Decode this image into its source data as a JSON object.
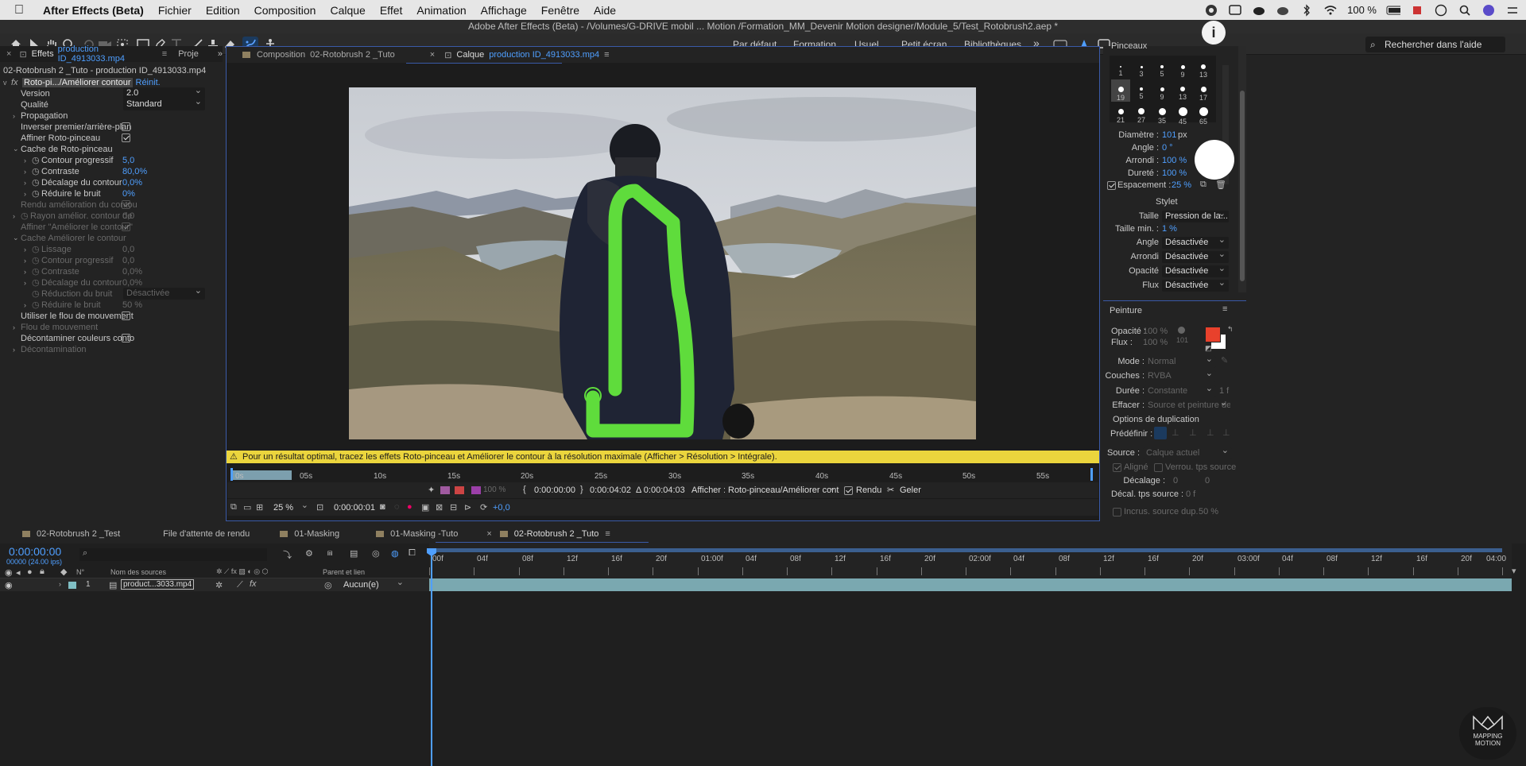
{
  "menubar": {
    "app_name": "After Effects (Beta)",
    "items": [
      "Fichier",
      "Edition",
      "Composition",
      "Calque",
      "Effet",
      "Animation",
      "Affichage",
      "Fenêtre",
      "Aide"
    ],
    "battery": "100 %"
  },
  "titlebar": {
    "title": "Adobe After Effects (Beta) - /Volumes/G-DRIVE mobil ... Motion /Formation_MM_Devenir Motion designer/Module_5/Test_Rotobrush2.aep *"
  },
  "workspaces": [
    "Par défaut",
    "Formation",
    "Usuel",
    "Petit écran",
    "Bibliothèques"
  ],
  "search_placeholder": "Rechercher dans l'aide",
  "effects_panel": {
    "tab_label": "Effets",
    "tab_layer": "production ID_4913033.mp4",
    "tab2": "Proje",
    "subtitle": "02-Rotobrush 2 _Tuto - production ID_4913033.mp4",
    "effect_name": "Roto-pi.../Améliorer contour",
    "reset": "Réinit.",
    "version_label": "Version",
    "version_value": "2.0",
    "quality_label": "Qualité",
    "quality_value": "Standard",
    "propagation": "Propagation",
    "invert": "Inverser premier/arrière-plan",
    "refine": "Affiner Roto-pinceau",
    "cache": "Cache de Roto-pinceau",
    "feather_label": "Contour progressif",
    "feather_value": "5,0",
    "contrast_label": "Contraste",
    "contrast_value": "80,0%",
    "shift_label": "Décalage du contour",
    "shift_value": "0,0%",
    "reduce_label": "Réduire le bruit",
    "reduce_value": "0%",
    "render_refine": "Rendu amélioration du contou",
    "radius_label": "Rayon amélior. contour de",
    "radius_value": "0,0",
    "refine_edge": "Affiner \"Améliorer le contour\"",
    "cache_refine": "Cache Améliorer le contour",
    "smooth_label": "Lissage",
    "smooth_value": "0,0",
    "feather2_label": "Contour progressif",
    "feather2_value": "0,0",
    "contrast2_label": "Contraste",
    "contrast2_value": "0,0%",
    "shift2_label": "Décalage du contour",
    "shift2_value": "0,0%",
    "noise_label": "Réduction du bruit",
    "noise_value": "Désactivée",
    "reduce2_label": "Réduire le bruit",
    "reduce2_value": "50 %",
    "motion_blur_use": "Utiliser le flou de mouvement",
    "motion_blur": "Flou de mouvement",
    "decontaminate": "Décontaminer couleurs conto",
    "decontamination": "Décontamination"
  },
  "viewer": {
    "tab1_prefix": "Composition",
    "tab1": "02-Rotobrush 2 _Tuto",
    "tab2_prefix": "Calque",
    "tab2": "production ID_4913033.mp4",
    "warning": "Pour un résultat optimal, tracez les effets Roto-pinceau et Améliorer le contour à la résolution maximale (Afficher > Résolution > Intégrale).",
    "ruler": [
      "0s",
      "05s",
      "10s",
      "15s",
      "20s",
      "25s",
      "30s",
      "35s",
      "40s",
      "45s",
      "50s",
      "55s"
    ],
    "timecode_in": "0:00:00:00",
    "timecode_out": "0:00:04:02",
    "duration": "Δ 0:00:04:03",
    "show_label": "Afficher :",
    "show_value": "Roto-pinceau/Améliorer cont...",
    "render": "Rendu",
    "freeze": "Geler",
    "zoom": "25 %",
    "current_time": "0:00:00:01",
    "exposure": "+0,0",
    "opacity_pct": "100 %"
  },
  "brushes_panel": {
    "title": "Pinceaux",
    "sizes": [
      "1",
      "3",
      "5",
      "9",
      "13",
      "19",
      "5",
      "9",
      "13",
      "17",
      "21",
      "27",
      "35",
      "45",
      "65"
    ],
    "diameter_label": "Diamètre :",
    "diameter_value": "101",
    "diameter_unit": "px",
    "angle_label": "Angle :",
    "angle_value": "0 °",
    "round_label": "Arrondi :",
    "round_value": "100 %",
    "hardness_label": "Dureté :",
    "hardness_value": "100 %",
    "spacing_label": "Espacement :",
    "spacing_value": "25 %",
    "stylus": "Stylet",
    "size_label": "Taille",
    "size_value": "Pression de la...",
    "minsize_label": "Taille min. :",
    "minsize_value": "1 %",
    "angle2_label": "Angle",
    "angle2_value": "Désactivée",
    "round2_label": "Arrondi",
    "round2_value": "Désactivée",
    "opacity_label": "Opacité",
    "opacity_value": "Désactivée",
    "flow_label": "Flux",
    "flow_value": "Désactivée"
  },
  "paint_panel": {
    "title": "Peinture",
    "opacity_label": "Opacité :",
    "opacity_value": "100 %",
    "flow_label": "Flux :",
    "flow_value": "100 %",
    "brush_num": "101",
    "fg_color": "#e8412c",
    "mode_label": "Mode :",
    "mode_value": "Normal",
    "channels_label": "Couches :",
    "channels_value": "RVBA",
    "duration_label": "Durée :",
    "duration_value": "Constante",
    "duration_frames": "1 f",
    "erase_label": "Effacer :",
    "erase_value": "Source et peinture de...",
    "clone_title": "Options de duplication",
    "preset_label": "Prédéfinir :",
    "source_label": "Source :",
    "source_value": "Calque actuel",
    "aligned": "Aligné",
    "lock_time": "Verrou. tps source",
    "offset_label": "Décalage :",
    "offset_value": "0",
    "offset_value2": "0",
    "time_offset_label": "Décal. tps source :",
    "time_offset_value": "0 f",
    "overlay_label": "Incrus. source dup.",
    "overlay_value": "50 %"
  },
  "timeline": {
    "tabs": [
      "02-Rotobrush 2 _Test",
      "File d'attente de rendu",
      "01-Masking",
      "01-Masking -Tuto",
      "02-Rotobrush 2 _Tuto"
    ],
    "current_time": "0:00:00:00",
    "fps": "00000 (24.00 ips)",
    "col_num": "N°",
    "col_source": "Nom des sources",
    "col_parent": "Parent et lien",
    "layer_num": "1",
    "layer_name": "product...3033.mp4",
    "layer_parent": "Aucun(e)",
    "ruler": [
      "00f",
      "04f",
      "08f",
      "12f",
      "16f",
      "20f",
      "01:00f",
      "04f",
      "08f",
      "12f",
      "16f",
      "20f",
      "02:00f",
      "04f",
      "08f",
      "12f",
      "16f",
      "20f",
      "03:00f",
      "04f",
      "08f",
      "12f",
      "16f",
      "20f",
      "04:00"
    ]
  },
  "watermark": {
    "text1": "MAPPING",
    "text2": "MOTION"
  }
}
